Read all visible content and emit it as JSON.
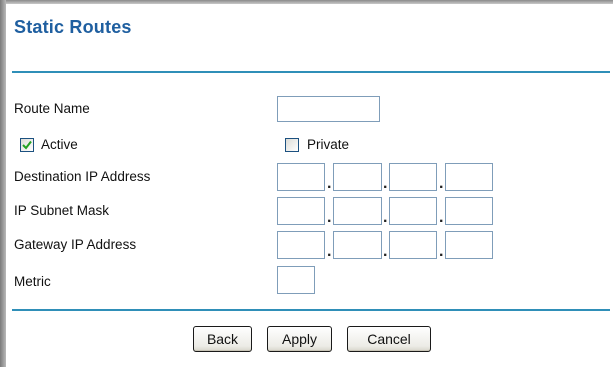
{
  "page": {
    "title": "Static Routes"
  },
  "form": {
    "route_name_label": "Route Name",
    "route_name_value": "",
    "active_label": "Active",
    "active_checked": true,
    "private_label": "Private",
    "private_checked": false,
    "destination_ip_label": "Destination IP Address",
    "destination_ip_octets": [
      "",
      "",
      "",
      ""
    ],
    "subnet_mask_label": "IP Subnet Mask",
    "subnet_mask_octets": [
      "",
      "",
      "",
      ""
    ],
    "gateway_ip_label": "Gateway IP Address",
    "gateway_ip_octets": [
      "",
      "",
      "",
      ""
    ],
    "metric_label": "Metric",
    "metric_value": "",
    "octet_separator": "."
  },
  "buttons": {
    "back_label": "Back",
    "apply_label": "Apply",
    "cancel_label": "Cancel"
  },
  "colors": {
    "title": "#1f5fa0",
    "rule": "#2f8fb8",
    "input_border": "#7f9db9",
    "checkmark": "#21a121"
  }
}
